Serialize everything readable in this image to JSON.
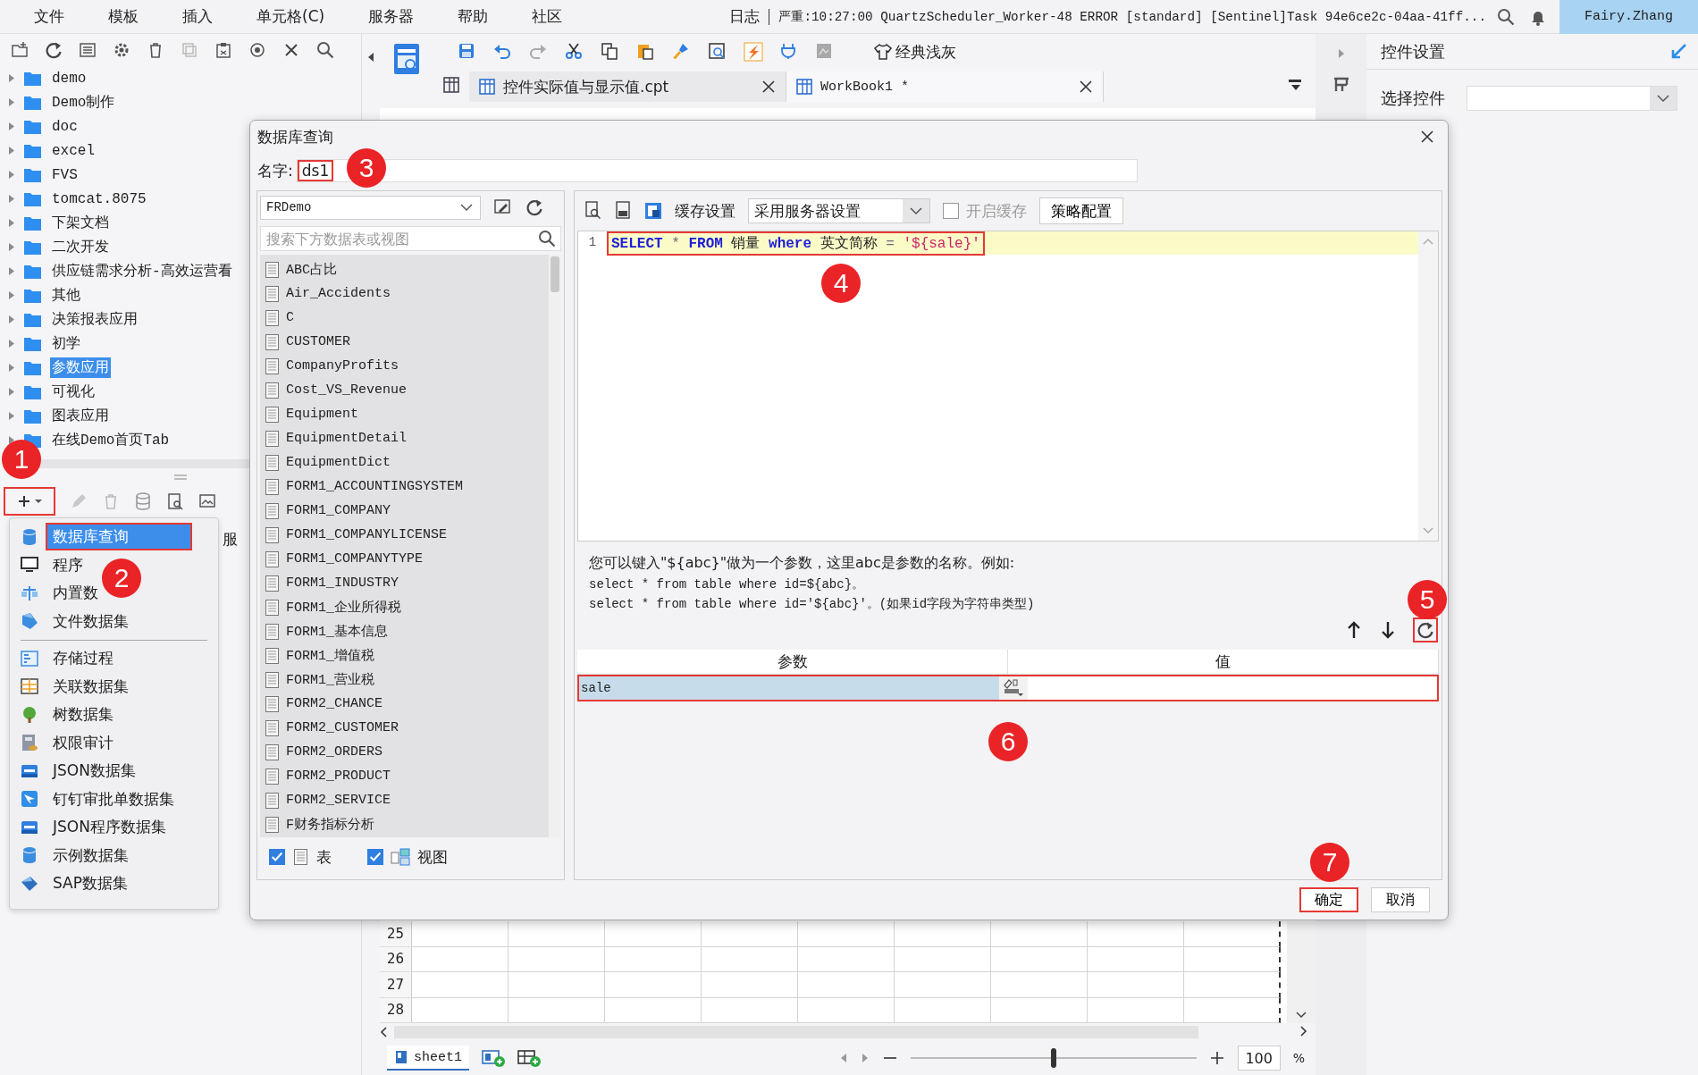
{
  "menu_bar": {
    "items": [
      "文件",
      "模板",
      "插入",
      "单元格(C)",
      "服务器",
      "帮助",
      "社区"
    ],
    "log_label": "日志",
    "log_message": "严重:10:27:00 QuartzScheduler_Worker-48 ERROR [standard] [Sentinel]Task 94e6ce2c-04aa-41ff...",
    "user": "Fairy.Zhang"
  },
  "file_tree": {
    "items": [
      {
        "label": "demo",
        "selected": false
      },
      {
        "label": "Demo制作",
        "selected": false
      },
      {
        "label": "doc",
        "selected": false
      },
      {
        "label": "excel",
        "selected": false
      },
      {
        "label": "FVS",
        "selected": false
      },
      {
        "label": "tomcat.8075",
        "selected": false
      },
      {
        "label": "下架文档",
        "selected": false
      },
      {
        "label": "二次开发",
        "selected": false
      },
      {
        "label": "供应链需求分析-高效运营看",
        "selected": false
      },
      {
        "label": "其他",
        "selected": false
      },
      {
        "label": "决策报表应用",
        "selected": false
      },
      {
        "label": "初学",
        "selected": false
      },
      {
        "label": "参数应用",
        "selected": true
      },
      {
        "label": "可视化",
        "selected": false
      },
      {
        "label": "图表应用",
        "selected": false
      },
      {
        "label": "在线Demo首页Tab",
        "selected": false
      }
    ]
  },
  "dataset_toolbar": {
    "add_highlighted": true,
    "hidden_tab": "服"
  },
  "dataset_menu": {
    "items": [
      {
        "label": "数据库查询",
        "selected": true,
        "highlighted": true,
        "separator_before": false
      },
      {
        "label": "程序",
        "selected": false,
        "highlighted": false,
        "separator_before": false
      },
      {
        "label": "内置数",
        "selected": false,
        "highlighted": false,
        "separator_before": false
      },
      {
        "label": "文件数据集",
        "selected": false,
        "highlighted": false,
        "separator_before": false
      },
      {
        "label": "存储过程",
        "selected": false,
        "highlighted": false,
        "separator_before": true
      },
      {
        "label": "关联数据集",
        "selected": false,
        "highlighted": false,
        "separator_before": false
      },
      {
        "label": "树数据集",
        "selected": false,
        "highlighted": false,
        "separator_before": false
      },
      {
        "label": "权限审计",
        "selected": false,
        "highlighted": false,
        "separator_before": false
      },
      {
        "label": "JSON数据集",
        "selected": false,
        "highlighted": false,
        "separator_before": false
      },
      {
        "label": "钉钉审批单数据集",
        "selected": false,
        "highlighted": false,
        "separator_before": false
      },
      {
        "label": "JSON程序数据集",
        "selected": false,
        "highlighted": false,
        "separator_before": false
      },
      {
        "label": "示例数据集",
        "selected": false,
        "highlighted": false,
        "separator_before": false
      },
      {
        "label": "SAP数据集",
        "selected": false,
        "highlighted": false,
        "separator_before": false
      }
    ]
  },
  "toolbar": {
    "theme_button": "经典浅灰"
  },
  "doc_tabs": [
    {
      "label": "控件实际值与显示值.cpt",
      "selected": false
    },
    {
      "label": "WorkBook1 *",
      "selected": true
    }
  ],
  "sheet": {
    "rows": [
      "25",
      "26",
      "27",
      "28"
    ]
  },
  "sheet_bar": {
    "tabs": [
      {
        "label": "sheet1",
        "selected": true
      }
    ],
    "zoom_slider": {
      "level": 0.5
    },
    "zoom": "100",
    "zoom_unit": "%"
  },
  "right_panel": {
    "title": "控件设置",
    "field_label": "选择控件"
  },
  "dialog": {
    "title": "数据库查询",
    "name_label": "名字:",
    "name": {
      "value": "ds1",
      "highlighted": true
    },
    "connection": "FRDemo",
    "search_placeholder": "搜索下方数据表或视图",
    "tables": [
      "ABC占比",
      "Air_Accidents",
      "C",
      "CUSTOMER",
      "CompanyProfits",
      "Cost_VS_Revenue",
      "Equipment",
      "EquipmentDetail",
      "EquipmentDict",
      "FORM1_ACCOUNTINGSYSTEM",
      "FORM1_COMPANY",
      "FORM1_COMPANYLICENSE",
      "FORM1_COMPANYTYPE",
      "FORM1_INDUSTRY",
      "FORM1_企业所得税",
      "FORM1_基本信息",
      "FORM1_增值税",
      "FORM1_营业税",
      "FORM2_CHANCE",
      "FORM2_CUSTOMER",
      "FORM2_ORDERS",
      "FORM2_PRODUCT",
      "FORM2_SERVICE",
      "F财务指标分析"
    ],
    "filters": [
      {
        "label": "表",
        "checked": true
      },
      {
        "label": "视图",
        "checked": true
      }
    ],
    "cache_label": "缓存设置",
    "cache_mode": "采用服务器设置",
    "enable_cache": {
      "label": "开启缓存",
      "checked": false
    },
    "strategy_button": "策略配置",
    "sql_lines": [
      {
        "number": "1",
        "highlighted": true,
        "tokens": [
          {
            "text": "SELECT",
            "kind": "keyword"
          },
          {
            "text": " * ",
            "kind": "operator"
          },
          {
            "text": "FROM",
            "kind": "keyword"
          },
          {
            "text": " 销量 ",
            "kind": "plain"
          },
          {
            "text": "where",
            "kind": "keyword"
          },
          {
            "text": " 英文简称 ",
            "kind": "plain"
          },
          {
            "text": "= ",
            "kind": "operator"
          },
          {
            "text": "'${sale}'",
            "kind": "string"
          }
        ]
      }
    ],
    "hint_lines": [
      "您可以键入\"${abc}\"做为一个参数，这里abc是参数的名称。例如:",
      "select * from table where id=${abc}。",
      "select * from table where id='${abc}'。(如果id字段为字符串类型)"
    ],
    "params": {
      "refresh_highlighted": true,
      "columns": [
        "参数",
        "值"
      ],
      "rows": [
        {
          "name": "sale",
          "selected": true,
          "highlighted": true
        }
      ]
    },
    "buttons": [
      {
        "label": "确定",
        "highlighted": true
      },
      {
        "label": "取消",
        "highlighted": false
      }
    ]
  },
  "annotations": [
    {
      "number": "1"
    },
    {
      "number": "2"
    },
    {
      "number": "3"
    },
    {
      "number": "4"
    },
    {
      "number": "5"
    },
    {
      "number": "6"
    },
    {
      "number": "7"
    }
  ]
}
